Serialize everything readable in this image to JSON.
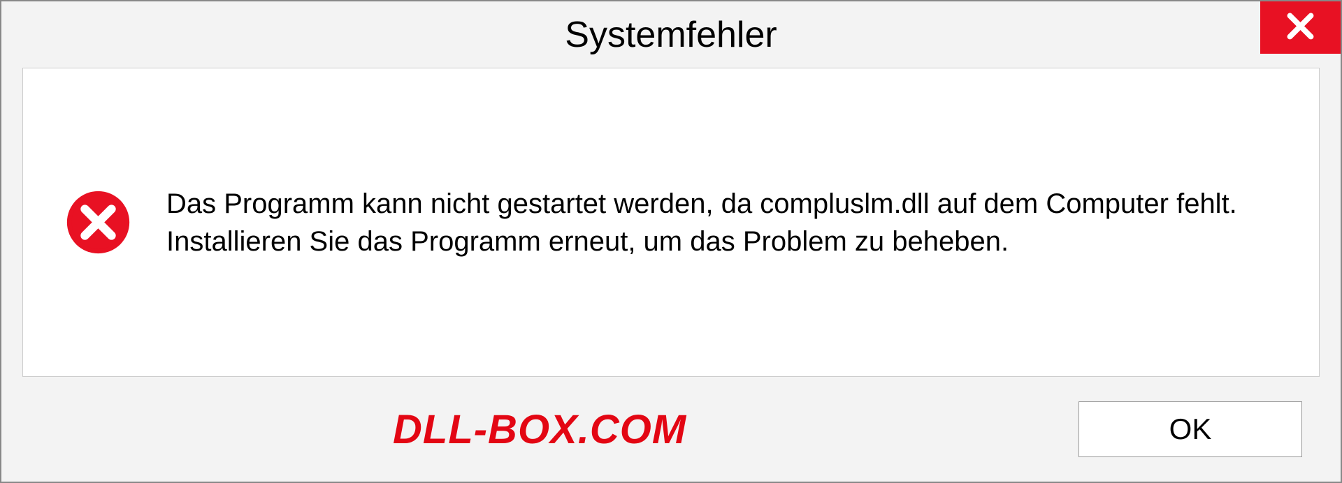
{
  "dialog": {
    "title": "Systemfehler",
    "message": "Das Programm kann nicht gestartet werden, da compluslm.dll auf dem Computer fehlt. Installieren Sie das Programm erneut, um das Problem zu beheben.",
    "ok_label": "OK"
  },
  "watermark": "DLL-BOX.COM",
  "colors": {
    "close_bg": "#e81123",
    "error_icon": "#e81123",
    "watermark_color": "#e30613"
  }
}
